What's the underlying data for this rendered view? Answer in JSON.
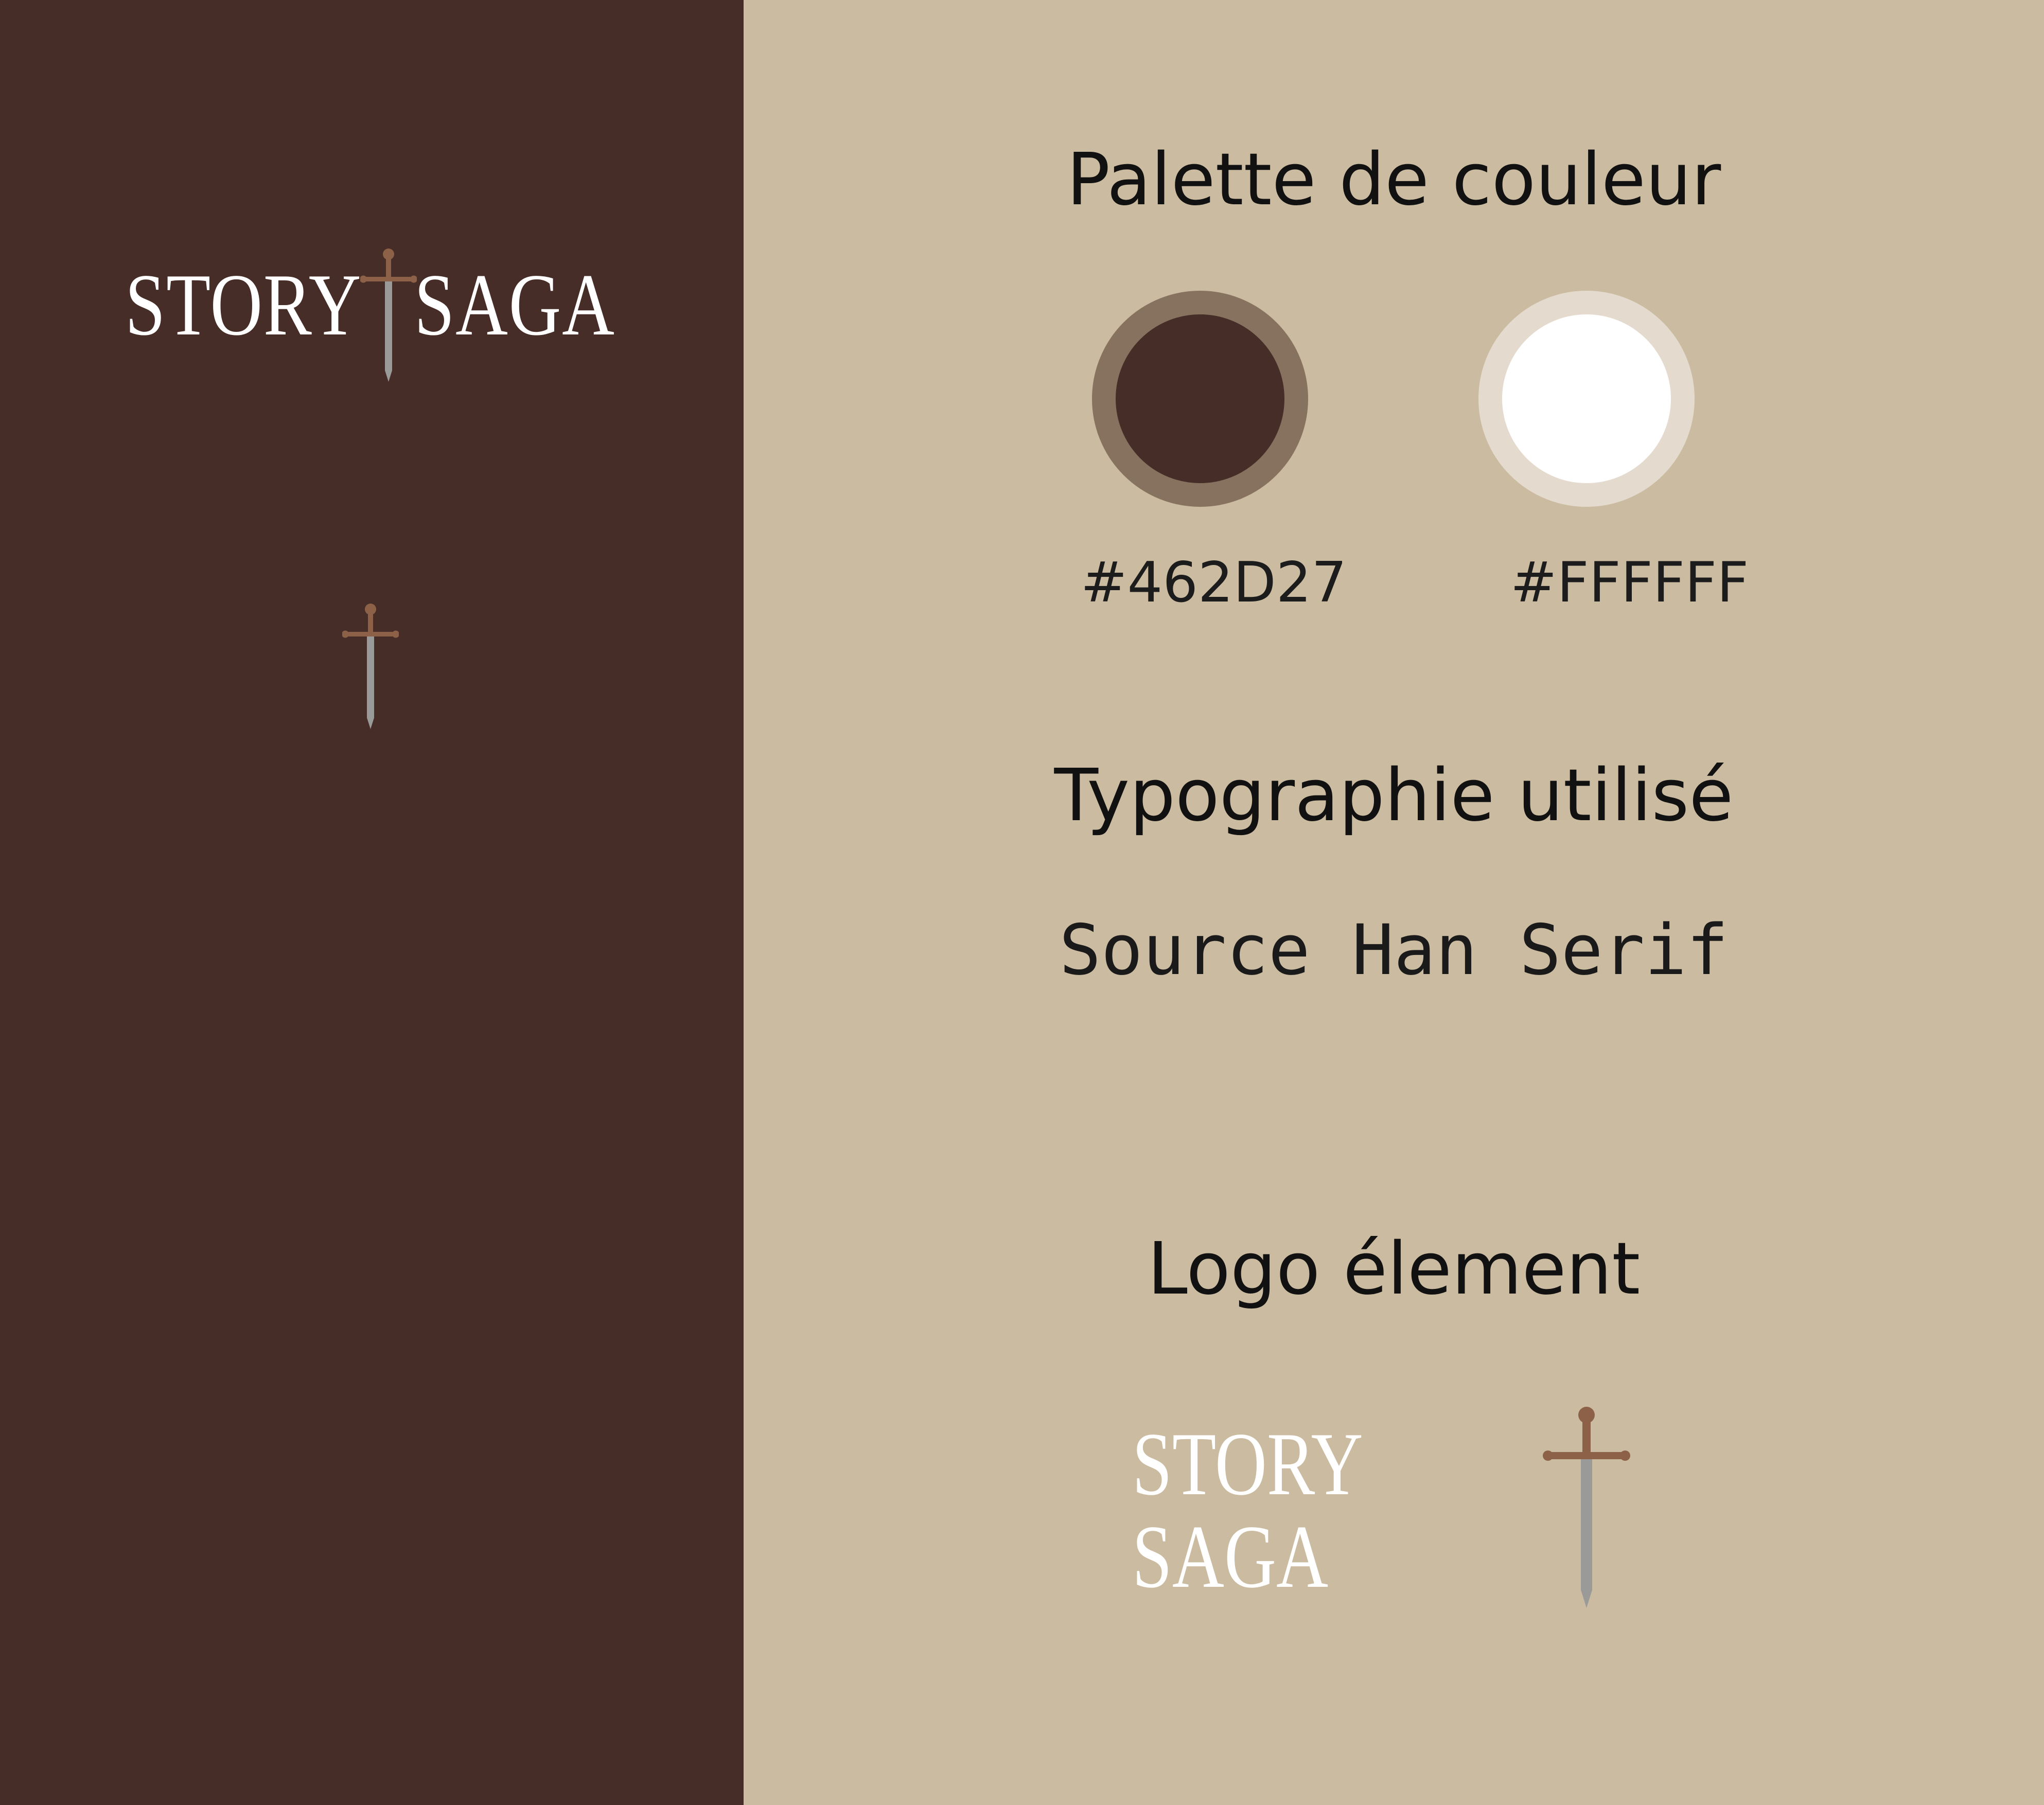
{
  "brand": {
    "word1": "STORY",
    "word2": "SAGA"
  },
  "sections": {
    "palette_title": "Palette de couleur",
    "typography_title": "Typographie utilisé",
    "logo_title": "Logo élement"
  },
  "palette": {
    "colors": [
      {
        "hex": "#462D27",
        "ring": "#877260"
      },
      {
        "hex": "#FFFFFF",
        "ring": "#E4DBCE"
      }
    ]
  },
  "typography": {
    "font_name": "Source Han Serif"
  },
  "icons": {
    "sword": "sword-icon"
  },
  "theme": {
    "dark_brown": "#462D27",
    "sand": "#CBBBA0",
    "copper": "#8C6148",
    "steel": "#9A9A98"
  }
}
